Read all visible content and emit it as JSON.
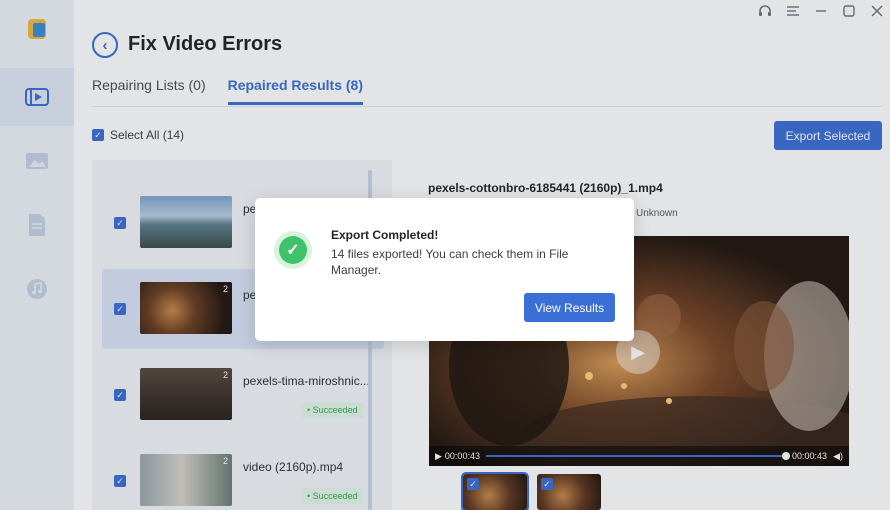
{
  "window": {
    "icons": [
      "headset-icon",
      "menu-icon",
      "minimize-icon",
      "maximize-icon",
      "close-icon"
    ]
  },
  "sidebar": {
    "items": [
      "app-logo-icon",
      "video-repair-icon",
      "photo-repair-icon",
      "file-repair-icon",
      "audio-repair-icon"
    ],
    "active_index": 1
  },
  "header": {
    "title": "Fix Video Errors"
  },
  "tabs": [
    {
      "label": "Repairing Lists (0)"
    },
    {
      "label": "Repaired Results (8)"
    }
  ],
  "toolbar": {
    "select_all": "Select All (14)",
    "export_button": "Export Selected"
  },
  "files": [
    {
      "name": "pe"
    },
    {
      "name": "pe",
      "count": "2"
    },
    {
      "name": "pexels-tima-miroshnic...",
      "count": "2",
      "status": "Succeeded"
    },
    {
      "name": "video (2160p).mp4",
      "count": "2",
      "status": "Succeeded"
    }
  ],
  "preview": {
    "title": "pexels-cottonbro-6185441 (2160p)_1.mp4",
    "meta": "Unknown",
    "time_current": "00:00:43",
    "time_total": "00:00:43",
    "progress": 1.0
  },
  "modal": {
    "title": "Export Completed!",
    "message": "14 files exported! You can check them in File Manager.",
    "button": "View Results"
  },
  "colors": {
    "accent": "#3b6fd6",
    "success": "#3ec36a"
  }
}
